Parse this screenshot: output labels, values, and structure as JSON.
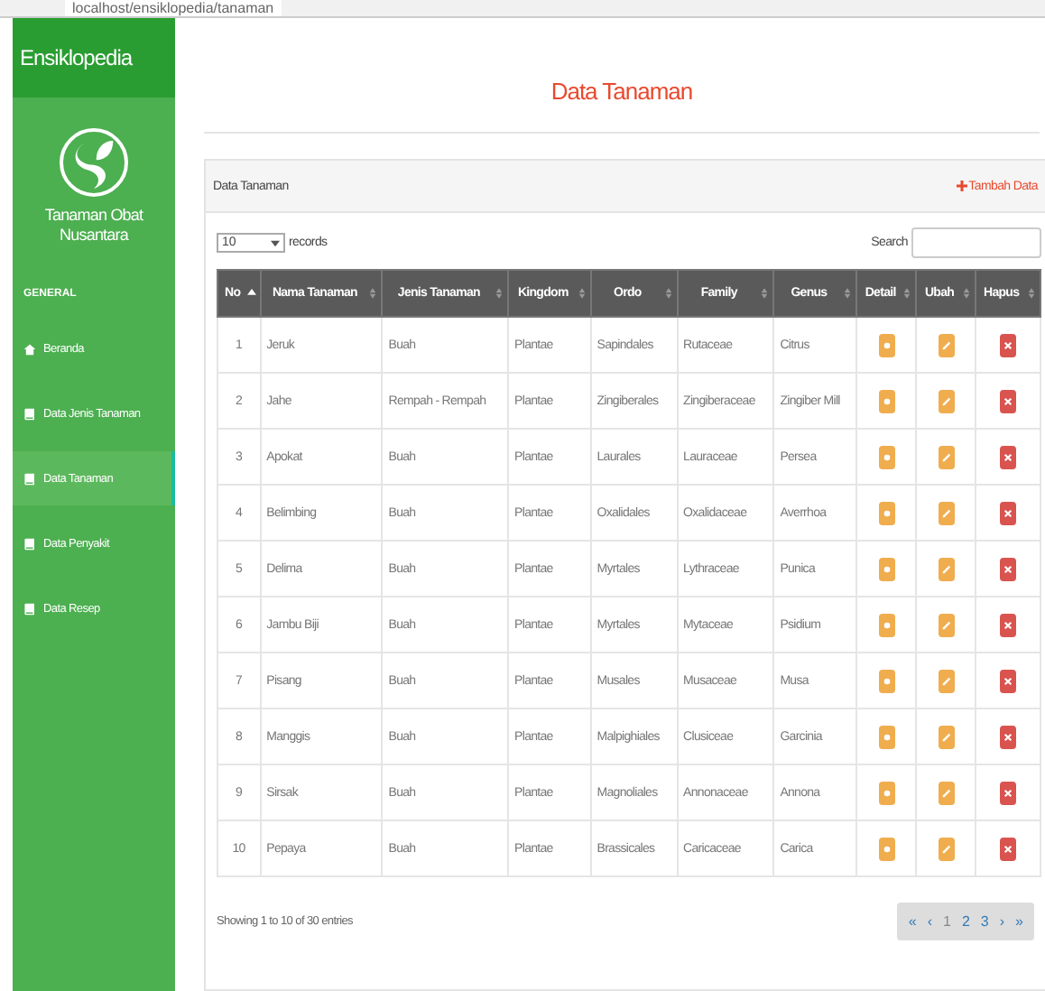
{
  "browser": {
    "url": "localhost/ensiklopedia/tanaman"
  },
  "sidebar": {
    "brand": "Ensiklopedia",
    "app_name": "Tanaman Obat Nusantara",
    "section": "GENERAL",
    "items": [
      {
        "label": "Beranda",
        "kind": "home",
        "selected": false
      },
      {
        "label": "Data Jenis Tanaman",
        "kind": "book",
        "selected": false
      },
      {
        "label": "Data Tanaman",
        "kind": "book",
        "selected": true
      },
      {
        "label": "Data Penyakit",
        "kind": "book",
        "selected": false
      },
      {
        "label": "Data Resep",
        "kind": "book",
        "selected": false
      }
    ]
  },
  "page_title": "Data Tanaman",
  "panel": {
    "title": "Data Tanaman",
    "add_button": "Tambah Data",
    "page_size": "10",
    "records_label": "records",
    "search_label": "Search",
    "columns": [
      {
        "label": "No",
        "sorted": true
      },
      {
        "label": "Nama Tanaman",
        "sorted": false
      },
      {
        "label": "Jenis Tanaman",
        "sorted": false
      },
      {
        "label": "Kingdom",
        "sorted": false
      },
      {
        "label": "Ordo",
        "sorted": false
      },
      {
        "label": "Family",
        "sorted": false
      },
      {
        "label": "Genus",
        "sorted": false
      },
      {
        "label": "Detail",
        "sorted": false
      },
      {
        "label": "Ubah",
        "sorted": false
      },
      {
        "label": "Hapus",
        "sorted": false
      }
    ],
    "rows": [
      [
        "1",
        "Jeruk",
        "Buah",
        "Plantae",
        "Sapindales",
        "Rutaceae",
        "Citrus"
      ],
      [
        "2",
        "Jahe",
        "Rempah - Rempah",
        "Plantae",
        "Zingiberales",
        "Zingiberaceae",
        "Zingiber Mill"
      ],
      [
        "3",
        "Apokat",
        "Buah",
        "Plantae",
        "Laurales",
        "Lauraceae",
        "Persea"
      ],
      [
        "4",
        "Belimbing",
        "Buah",
        "Plantae",
        "Oxalidales",
        "Oxalidaceae",
        "Averrhoa"
      ],
      [
        "5",
        "Delima",
        "Buah",
        "Plantae",
        "Myrtales",
        "Lythraceae",
        "Punica"
      ],
      [
        "6",
        "Jambu Biji",
        "Buah",
        "Plantae",
        "Myrtales",
        "Mytaceae",
        "Psidium"
      ],
      [
        "7",
        "Pisang",
        "Buah",
        "Plantae",
        "Musales",
        "Musaceae",
        "Musa"
      ],
      [
        "8",
        "Manggis",
        "Buah",
        "Plantae",
        "Malpighiales",
        "Clusiceae",
        "Garcinia"
      ],
      [
        "9",
        "Sirsak",
        "Buah",
        "Plantae",
        "Magnoliales",
        "Annonaceae",
        "Annona"
      ],
      [
        "10",
        "Pepaya",
        "Buah",
        "Plantae",
        "Brassicales",
        "Caricaceae",
        "Carica"
      ]
    ],
    "info": "Showing 1 to 10 of 30 entries",
    "pagination": [
      {
        "label": "«",
        "selected": false
      },
      {
        "label": "‹",
        "selected": false
      },
      {
        "label": "1",
        "selected": true
      },
      {
        "label": "2",
        "selected": false
      },
      {
        "label": "3",
        "selected": false
      },
      {
        "label": "›",
        "selected": false
      },
      {
        "label": "»",
        "selected": false
      }
    ]
  }
}
